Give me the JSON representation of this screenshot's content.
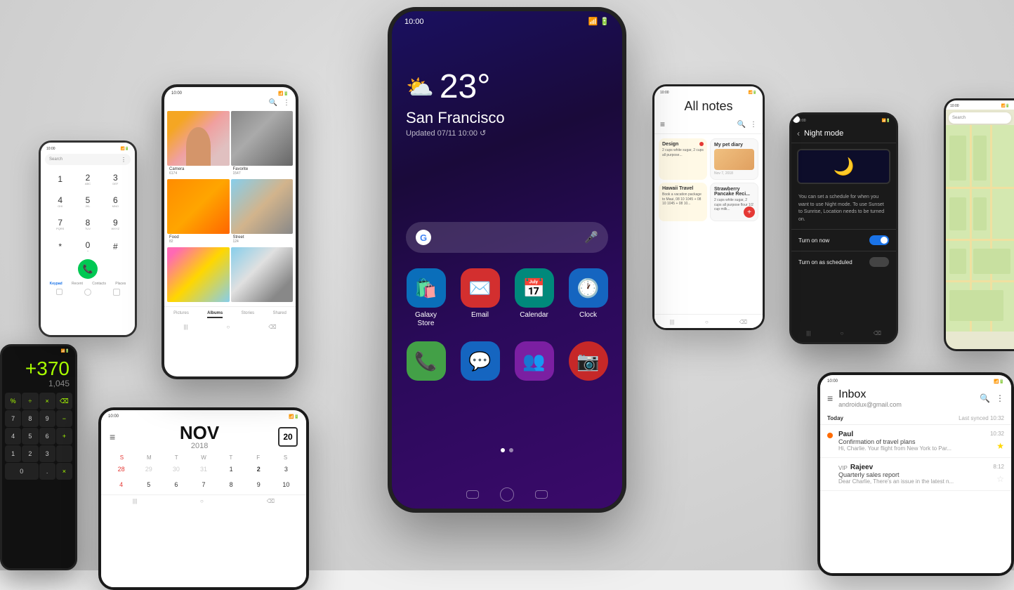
{
  "background": "#e8e8e8",
  "phones": {
    "center": {
      "status": {
        "time": "10:00",
        "wifi": "wifi",
        "signal": "signal",
        "battery": "battery"
      },
      "weather": {
        "temp": "23°",
        "city": "San Francisco",
        "updated": "Updated 07/11 10:00 ↺"
      },
      "search": {
        "placeholder": ""
      },
      "apps_row1": [
        {
          "label": "Galaxy\nStore",
          "color": "#0066cc",
          "icon": "🛍️"
        },
        {
          "label": "Email",
          "color": "#d32f2f",
          "icon": "✉️"
        },
        {
          "label": "Calendar",
          "color": "#00897b",
          "icon": "📅"
        },
        {
          "label": "Clock",
          "color": "#1565c0",
          "icon": "🕐"
        }
      ],
      "apps_row2": [
        {
          "label": "",
          "color": "#43a047",
          "icon": "📞"
        },
        {
          "label": "",
          "color": "#1565c0",
          "icon": "💬"
        },
        {
          "label": "",
          "color": "#7b1fa2",
          "icon": "👥"
        },
        {
          "label": "",
          "color": "#c62828",
          "icon": "📷"
        }
      ]
    },
    "dialer": {
      "time": "10:00",
      "keys": [
        "1",
        "2",
        "3",
        "4",
        "5",
        "6",
        "7",
        "8",
        "9",
        "*",
        "0",
        "#"
      ],
      "sub_labels": [
        "",
        "ABC",
        "DEF",
        "GHI",
        "JKL",
        "MNO",
        "PQRS",
        "TUV",
        "WXYZ",
        "",
        "+ ",
        ""
      ],
      "tabs": [
        "Keypad",
        "Recent",
        "Contacts",
        "Places"
      ]
    },
    "gallery": {
      "time": "10:00",
      "albums": [
        {
          "label": "Camera",
          "count": "6174"
        },
        {
          "label": "Favorite",
          "count": "1547"
        },
        {
          "label": "Food",
          "count": "82"
        },
        {
          "label": "Street",
          "count": "124"
        },
        {
          "label": "",
          "count": ""
        },
        {
          "label": "",
          "count": ""
        }
      ],
      "tabs": [
        "Pictures",
        "Albums",
        "Stories",
        "Shared"
      ]
    },
    "calculator": {
      "time": "",
      "display": "+370",
      "sub": "1,045",
      "buttons": [
        "%",
        "÷",
        "×",
        "⌫",
        "7",
        "8",
        "9",
        "-",
        "4",
        "5",
        "6",
        "+",
        "1",
        "2",
        "3",
        "",
        "0",
        "",
        ".",
        "+"
      ]
    },
    "calendar": {
      "time": "10:00",
      "month": "NOV",
      "year": "2018",
      "today": "20",
      "day_headers": [
        "S",
        "M",
        "T",
        "W",
        "T",
        "F",
        "S"
      ],
      "days": [
        "28",
        "29",
        "30",
        "31",
        "1",
        "2",
        "3",
        "4",
        "5",
        "6",
        "7",
        "8",
        "9",
        "10"
      ],
      "inactive_days": [
        "28",
        "29",
        "30",
        "31"
      ]
    },
    "notes": {
      "time": "10:00",
      "title": "All notes",
      "cards": [
        {
          "title": "Design",
          "text": "2 cups white sugar...",
          "date": "",
          "type": "yellow"
        },
        {
          "title": "My pet diary",
          "text": "",
          "date": "Nov 7, 2018",
          "type": "white"
        },
        {
          "title": "Hawaii Travel",
          "text": "Book a vacation package to Maui...",
          "date": "",
          "type": "yellow"
        },
        {
          "title": "Strawberry Pancake Reci...",
          "text": "2 cups white sugar, 2 cups all purpose flour...",
          "date": "",
          "type": "white"
        }
      ]
    },
    "nightmode": {
      "time": "10:00",
      "title": "Night mode",
      "description": "You can set a schedule for when you want to use Night mode. To use Sunset to Sunrise, Location needs to be turned on.",
      "toggles": [
        {
          "label": "Turn on now",
          "state": true
        },
        {
          "label": "Turn on as scheduled",
          "state": false
        }
      ]
    },
    "email": {
      "time": "10:00",
      "inbox_label": "Inbox",
      "email_addr": "androidux@gmail.com",
      "today": "Today",
      "last_synced": "Last synced 10:32",
      "emails": [
        {
          "sender": "Paul",
          "subject": "Confirmation of travel plans",
          "preview": "Hi, Charlie. Your flight from New York to Par...",
          "time": "10:32",
          "unread": true,
          "starred": true
        },
        {
          "sender": "Rajeev",
          "vip": "VIP",
          "subject": "Quarterly sales report",
          "preview": "Dear Charlie, There's an issue in the latest n...",
          "time": "8:12",
          "unread": false,
          "starred": false
        }
      ]
    }
  }
}
